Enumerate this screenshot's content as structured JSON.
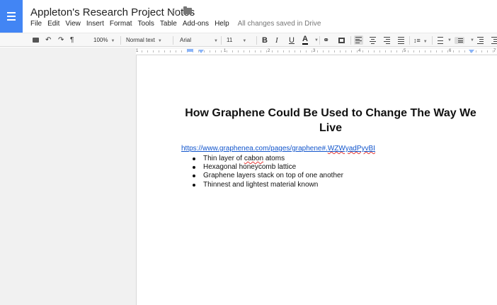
{
  "app": {
    "title": "Appleton's Research Project Notes",
    "save_status": "All changes saved in Drive"
  },
  "menu": [
    "File",
    "Edit",
    "View",
    "Insert",
    "Format",
    "Tools",
    "Table",
    "Add-ons",
    "Help"
  ],
  "toolbar": {
    "zoom": "100%",
    "style": "Normal text",
    "font": "Arial",
    "font_size": "11",
    "bold": "B",
    "italic": "I",
    "underline": "U",
    "text_color": "A"
  },
  "ruler": {
    "numbers": [
      "1",
      "1",
      "2",
      "3",
      "4",
      "5",
      "6",
      "7"
    ]
  },
  "document": {
    "heading": "How Graphene Could Be Used to Change The Way We Live",
    "link_prefix": "https://www.graphenea.com/pages/graphene#.",
    "link_suffix": "WZWyadPyvBI",
    "bullets": [
      {
        "before": "Thin layer of ",
        "misspelled": "cabon",
        "after": " atoms"
      },
      {
        "before": "Hexagonal honeycomb lattice",
        "misspelled": "",
        "after": ""
      },
      {
        "before": "Graphene layers stack on top of one another",
        "misspelled": "",
        "after": ""
      },
      {
        "before": "Thinnest and lightest material known",
        "misspelled": "",
        "after": ""
      }
    ]
  },
  "colors": {
    "brand": "#4285f4",
    "link": "#1155cc",
    "spellcheck": "#e53935"
  }
}
